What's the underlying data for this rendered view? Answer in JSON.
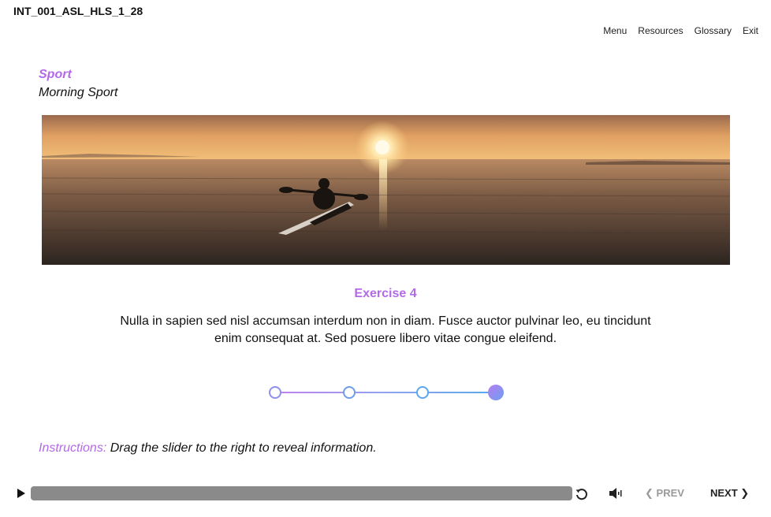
{
  "header": {
    "course_id": "INT_001_ASL_HLS_1_28",
    "nav": {
      "menu": "Menu",
      "resources": "Resources",
      "glossary": "Glossary",
      "exit": "Exit"
    }
  },
  "lesson": {
    "topic": "Sport",
    "subtopic": "Morning Sport"
  },
  "exercise": {
    "title": "Exercise 4",
    "body": "Nulla in sapien sed nisl accumsan interdum non in diam. Fusce auctor pulvinar leo, eu tincidunt enim consequat at. Sed posuere libero vitae congue eleifend.",
    "slider": {
      "stops": 4,
      "current": 4
    }
  },
  "instructions": {
    "label": "Instructions:",
    "text": "Drag the slider to the right to reveal information."
  },
  "player": {
    "prev_label": "PREV",
    "next_label": "NEXT",
    "prev_enabled": false,
    "icons": {
      "play": "play-icon",
      "replay": "replay-icon",
      "volume": "volume-icon"
    }
  },
  "colors": {
    "accent": "#b36ae8",
    "slider_blue": "#5aa7ec",
    "progress_bar": "#8a8a8a"
  }
}
